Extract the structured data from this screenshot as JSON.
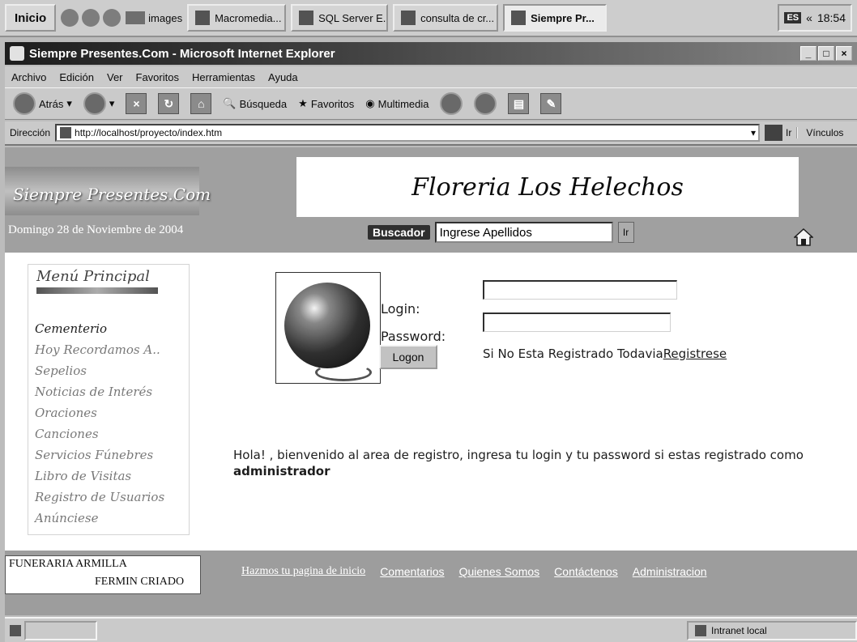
{
  "taskbar": {
    "start_label": "Inicio",
    "quicklaunch_folder": "images",
    "tasks": [
      "Macromedia...",
      "SQL Server E...",
      "consulta de cr...",
      "Siempre Pr..."
    ],
    "lang": "ES",
    "clock": "18:54"
  },
  "window": {
    "title": "Siempre Presentes.Com - Microsoft Internet Explorer",
    "menu": [
      "Archivo",
      "Edición",
      "Ver",
      "Favoritos",
      "Herramientas",
      "Ayuda"
    ],
    "toolbar": {
      "back": "Atrás",
      "search": "Búsqueda",
      "favorites": "Favoritos",
      "media": "Multimedia"
    },
    "address_label": "Dirección",
    "address_url": "http://localhost/proyecto/index.htm",
    "go_label": "Ir",
    "links_label": "Vínculos"
  },
  "header": {
    "site_logo": "Siempre Presentes.Com",
    "date": "Domingo 28 de Noviembre de 2004",
    "florist": "Floreria Los Helechos",
    "search_label": "Buscador",
    "search_value": "Ingrese Apellidos",
    "search_go": "Ir"
  },
  "menu": {
    "title": "Menú Principal",
    "items": [
      "Cementerio",
      "Hoy Recordamos A..",
      "Sepelios",
      "Noticias de Interés",
      "Oraciones",
      "Canciones",
      "Servicios Fúnebres",
      "Libro de Visitas",
      "Registro de Usuarios",
      "Anúnciese"
    ]
  },
  "login": {
    "login_label": "Login:",
    "password_label": "Password:",
    "button": "Logon",
    "register_text": "Si No Esta Registrado Todavia",
    "register_link": "Registrese"
  },
  "welcome": {
    "text": "Hola! , bienvenido al area de registro, ingresa tu login y tu password si estas registrado como ",
    "bold": "administrador"
  },
  "footer": {
    "line1": "FUNERARIA ARMILLA",
    "line2": "FERMIN CRIADO",
    "links": [
      "Hazmos tu pagina de inicio",
      "Comentarios",
      "Quienes Somos",
      "Contáctenos",
      "Administracion"
    ]
  },
  "status": {
    "zone": "Intranet local"
  }
}
